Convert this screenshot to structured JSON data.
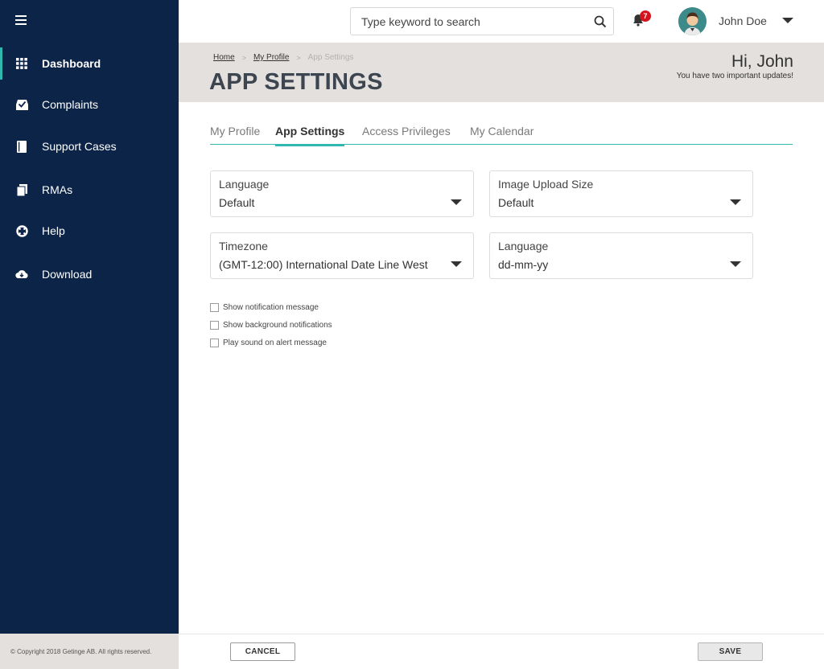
{
  "sidebar": {
    "items": [
      {
        "label": "Dashboard",
        "icon": "grid-icon"
      },
      {
        "label": "Complaints",
        "icon": "inbox-icon"
      },
      {
        "label": "Support Cases",
        "icon": "book-icon"
      },
      {
        "label": "RMAs",
        "icon": "documents-icon"
      },
      {
        "label": "Help",
        "icon": "lifebuoy-icon"
      },
      {
        "label": "Download",
        "icon": "cloud-download-icon"
      }
    ],
    "copyright": "© Copyright 2018 Getinge AB. All rights reserved."
  },
  "topbar": {
    "search_placeholder": "Type keyword to search",
    "notification_count": "7",
    "user_name": "John Doe"
  },
  "header": {
    "breadcrumb": [
      "Home",
      "My Profile",
      "App Settings"
    ],
    "title": "APP SETTINGS",
    "greeting": "Hi, John",
    "greeting_sub": "You have two important updates!"
  },
  "tabs": [
    {
      "label": "My Profile",
      "active": false
    },
    {
      "label": "App Settings",
      "active": true
    },
    {
      "label": "Access Privileges",
      "active": false
    },
    {
      "label": "My Calendar",
      "active": false
    }
  ],
  "fields": [
    {
      "label": "Language",
      "value": "Default"
    },
    {
      "label": "Image Upload Size",
      "value": "Default"
    },
    {
      "label": "Timezone",
      "value": "(GMT-12:00) International Date Line West"
    },
    {
      "label": "Language",
      "value": "dd-mm-yy"
    }
  ],
  "checkboxes": [
    {
      "label": "Show notification message",
      "checked": false
    },
    {
      "label": "Show background notifications",
      "checked": false
    },
    {
      "label": "Play sound on alert message",
      "checked": false
    }
  ],
  "actions": {
    "cancel": "CANCEL",
    "save": "SAVE"
  },
  "colors": {
    "sidebar_bg": "#0c2448",
    "accent": "#2fb7b0",
    "header_band": "#e3e0dd",
    "badge": "#d4151d"
  }
}
